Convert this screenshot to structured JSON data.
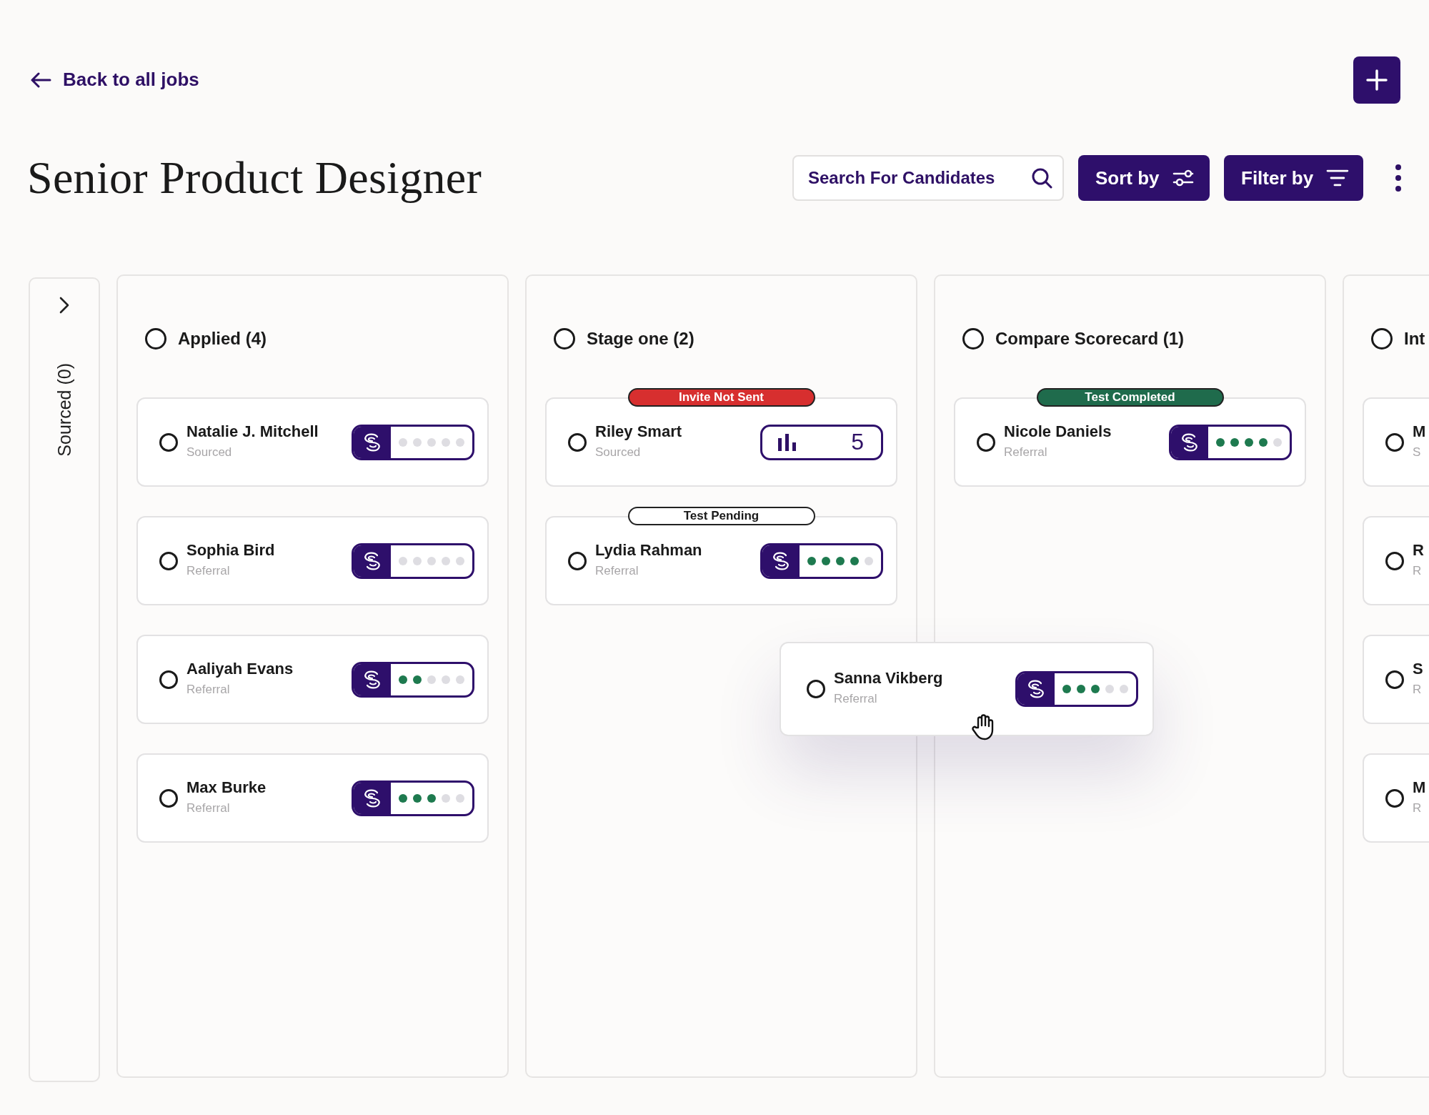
{
  "back_link": {
    "label": "Back to all jobs"
  },
  "title": "Senior Product Designer",
  "search": {
    "placeholder": "Search For Candidates"
  },
  "sort_button": {
    "label": "Sort by"
  },
  "filter_button": {
    "label": "Filter by"
  },
  "sourced_column": {
    "label": "Sourced (0)"
  },
  "columns": [
    {
      "title": "Applied (4)",
      "selected": false,
      "cards": [
        {
          "name": "Natalie J. Mitchell",
          "source": "Sourced",
          "selected": false,
          "rating": {
            "kind": "score",
            "stars": 0
          }
        },
        {
          "name": "Sophia Bird",
          "source": "Referral",
          "selected": false,
          "rating": {
            "kind": "score",
            "stars": 0
          }
        },
        {
          "name": "Aaliyah Evans",
          "source": "Referral",
          "selected": false,
          "rating": {
            "kind": "score",
            "stars": 2
          }
        },
        {
          "name": "Max Burke",
          "source": "Referral",
          "selected": false,
          "rating": {
            "kind": "score",
            "stars": 3
          }
        }
      ]
    },
    {
      "title": "Stage one (2)",
      "selected": false,
      "cards": [
        {
          "name": "Riley Smart",
          "source": "Sourced",
          "selected": false,
          "badge": {
            "kind": "alert",
            "label": "Invite Not Sent"
          },
          "rating": {
            "kind": "count",
            "value": "5"
          }
        },
        {
          "name": "Lydia Rahman",
          "source": "Referral",
          "selected": false,
          "badge": {
            "kind": "pending",
            "label": "Test Pending"
          },
          "rating": {
            "kind": "score",
            "stars": 4
          }
        }
      ]
    },
    {
      "title": "Compare Scorecard (1)",
      "selected": false,
      "cards": [
        {
          "name": "Nicole Daniels",
          "source": "Referral",
          "selected": false,
          "badge": {
            "kind": "done",
            "label": "Test Completed"
          },
          "rating": {
            "kind": "score",
            "stars": 4
          }
        }
      ]
    },
    {
      "title": "Int",
      "selected": false,
      "cards": [
        {
          "name": "M",
          "source": "S",
          "selected": false
        },
        {
          "name": "R",
          "source": "R",
          "selected": false
        },
        {
          "name": "S",
          "source": "R",
          "selected": false
        },
        {
          "name": "M",
          "source": "R",
          "selected": false
        }
      ]
    }
  ],
  "dragged_card": {
    "name": "Sanna Vikberg",
    "source": "Referral",
    "selected": false,
    "rating": {
      "kind": "score",
      "stars": 3
    }
  }
}
